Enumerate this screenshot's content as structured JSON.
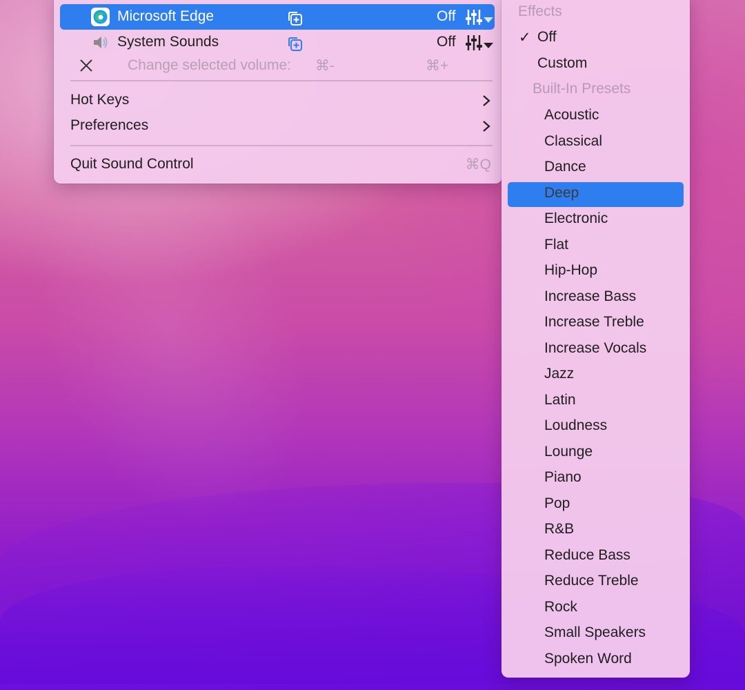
{
  "main_menu": {
    "apps": [
      {
        "name": "Microsoft Edge",
        "effect": "Off",
        "icon": "edge-icon",
        "highlighted": true
      },
      {
        "name": "System Sounds",
        "effect": "Off",
        "icon": "speaker-icon",
        "highlighted": false
      }
    ],
    "change_volume": {
      "label": "Change selected volume:",
      "decrease": "⌘-",
      "increase": "⌘+"
    },
    "hot_keys": "Hot Keys",
    "preferences": "Preferences",
    "quit": "Quit Sound Control",
    "quit_shortcut": "⌘Q"
  },
  "effects_menu": {
    "header": "Effects",
    "checkmark": "✓",
    "off": "Off",
    "custom": "Custom",
    "presets_header": "Built-In Presets",
    "selected": "Deep",
    "presets": [
      "Acoustic",
      "Classical",
      "Dance",
      "Deep",
      "Electronic",
      "Flat",
      "Hip-Hop",
      "Increase Bass",
      "Increase Treble",
      "Increase Vocals",
      "Jazz",
      "Latin",
      "Loudness",
      "Lounge",
      "Piano",
      "Pop",
      "R&B",
      "Reduce Bass",
      "Reduce Treble",
      "Rock",
      "Small Speakers",
      "Spoken Word"
    ]
  },
  "colors": {
    "highlight": "#2f7ef0",
    "menu_bg": "#f4caec"
  }
}
